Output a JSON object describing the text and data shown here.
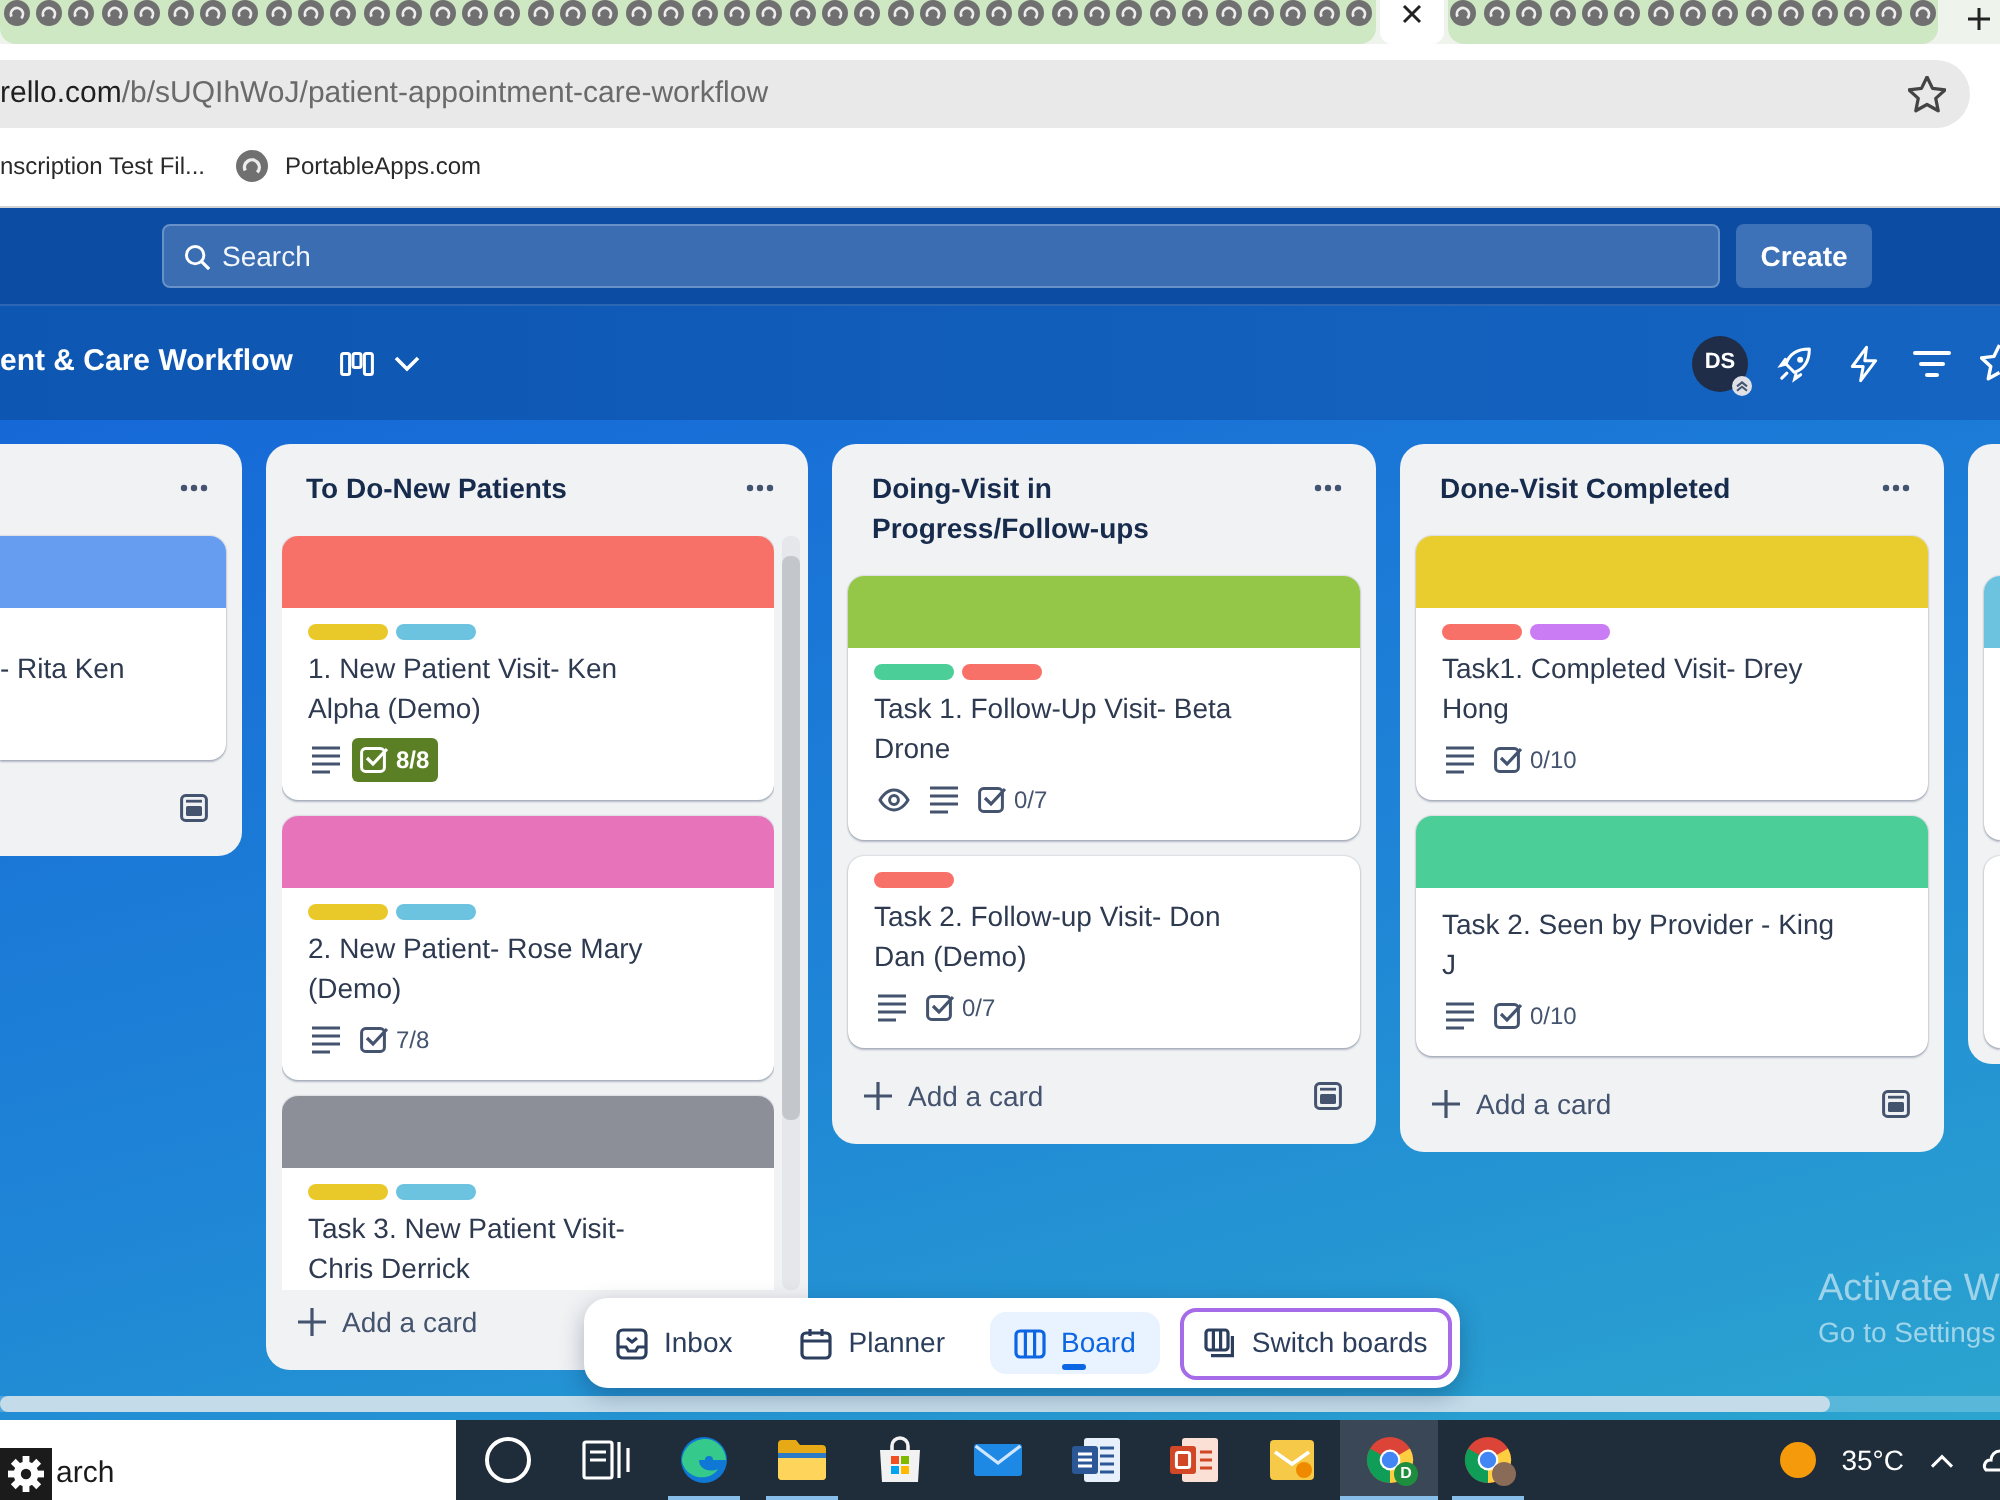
{
  "browser": {
    "tab_groups": [
      {
        "color": "#cfe8c4",
        "tabs": [
          {
            "selected": false
          },
          {
            "selected": false
          },
          {
            "selected": false
          },
          {
            "selected": false
          },
          {
            "selected": false
          },
          {
            "selected": false
          },
          {
            "selected": false
          },
          {
            "selected": false
          },
          {
            "selected": false
          },
          {
            "selected": false
          },
          {
            "selected": false
          },
          {
            "selected": false
          },
          {
            "selected": false
          },
          {
            "selected": false
          },
          {
            "selected": false
          },
          {
            "selected": false
          },
          {
            "selected": false
          },
          {
            "selected": false
          },
          {
            "selected": false
          },
          {
            "selected": false
          },
          {
            "selected": false
          },
          {
            "selected": false
          },
          {
            "selected": false
          },
          {
            "selected": false
          },
          {
            "selected": false
          },
          {
            "selected": false
          },
          {
            "selected": false
          },
          {
            "selected": false
          },
          {
            "selected": false
          },
          {
            "selected": false
          },
          {
            "selected": false
          },
          {
            "selected": false
          },
          {
            "selected": false
          },
          {
            "selected": false
          },
          {
            "selected": false
          },
          {
            "selected": false
          },
          {
            "selected": false
          },
          {
            "selected": false
          },
          {
            "selected": false
          },
          {
            "selected": false
          },
          {
            "selected": false
          },
          {
            "selected": false
          }
        ]
      },
      {
        "tabs": [
          {
            "selected": true
          }
        ]
      },
      {
        "color": "#cfe8c4",
        "tabs": [
          {
            "selected": false
          },
          {
            "selected": false
          },
          {
            "selected": false
          },
          {
            "selected": false
          },
          {
            "selected": false
          },
          {
            "selected": false
          },
          {
            "selected": false
          },
          {
            "selected": false
          },
          {
            "selected": false
          },
          {
            "selected": false
          },
          {
            "selected": false
          },
          {
            "selected": false
          },
          {
            "selected": false
          },
          {
            "selected": false
          },
          {
            "selected": false
          }
        ]
      }
    ],
    "address_bar": {
      "host": "rello.com",
      "path": "/b/sUQIhWoJ/patient-appointment-care-workflow"
    },
    "bookmarks": [
      {
        "label": "nscription Test Fil..."
      },
      {
        "label": "PortableApps.com",
        "icon": true
      }
    ]
  },
  "top_bar": {
    "search": {
      "placeholder": "Search"
    },
    "create_label": "Create"
  },
  "board_header": {
    "title": "ent & Care Workflow",
    "avatar": {
      "initials": "DS"
    }
  },
  "lists": [
    {
      "cards": [
        {
          "color": "#669df1",
          "title": "- Rita Ken"
        }
      ],
      "template": true
    },
    {
      "title": "To Do-New Patients",
      "overflow": true,
      "cards": [
        {
          "color": "#f87168",
          "labels": [
            {
              "color": "#e9c92a"
            },
            {
              "color": "#6cc3e0"
            }
          ],
          "title": "1. New Patient Visit- Ken Alpha (Demo)",
          "description": true,
          "checklist": {
            "text": "8/8",
            "complete": true
          }
        },
        {
          "color": "#e774bb",
          "labels": [
            {
              "color": "#e9c92a"
            },
            {
              "color": "#6cc3e0"
            }
          ],
          "title": "2. New Patient- Rose Mary (Demo)",
          "description": true,
          "checklist": {
            "text": "7/8",
            "complete": false
          }
        },
        {
          "color": "#8c8f97",
          "labels": [
            {
              "color": "#e9c92a"
            },
            {
              "color": "#6cc3e0"
            }
          ],
          "title": "Task 3. New Patient Visit- Chris Derrick"
        }
      ],
      "add_label": "Add a card"
    },
    {
      "title": "Doing-Visit in Progress/Follow-ups",
      "cards": [
        {
          "color": "#94c748",
          "labels": [
            {
              "color": "#4bce97"
            },
            {
              "color": "#f87168"
            }
          ],
          "title": "Task 1. Follow-Up Visit- Beta Drone",
          "watching": true,
          "description": true,
          "checklist": {
            "text": "0/7",
            "complete": false
          }
        },
        {
          "labels": [
            {
              "color": "#f87168"
            }
          ],
          "title": "Task 2. Follow-up Visit- Don Dan (Demo)",
          "description": true,
          "checklist": {
            "text": "0/7",
            "complete": false
          }
        }
      ],
      "add_label": "Add a card",
      "template": true
    },
    {
      "title": "Done-Visit Completed",
      "cards": [
        {
          "color": "#e9cd2f",
          "labels": [
            {
              "color": "#f87168"
            },
            {
              "color": "#c97cf4"
            }
          ],
          "title": "Task1. Completed Visit- Drey Hong",
          "description": true,
          "checklist": {
            "text": "0/10",
            "complete": false
          }
        },
        {
          "color": "#4bce97",
          "title": "Task 2. Seen by Provider - King J",
          "description": true,
          "checklist": {
            "text": "0/10",
            "complete": false
          }
        }
      ],
      "add_label": "Add a card",
      "template": true
    },
    {
      "cards": [
        {
          "kind": "sliver",
          "color": "#6cc3e0"
        },
        {
          "kind": "sliver"
        }
      ]
    }
  ],
  "bottom_nav": [
    {
      "kind": "inbox",
      "label": "Inbox",
      "selected": false
    },
    {
      "kind": "planner",
      "label": "Planner",
      "selected": false
    },
    {
      "kind": "board",
      "label": "Board",
      "selected": true
    },
    {
      "kind": "switcher",
      "label": "Switch boards",
      "selected": false
    }
  ],
  "windows_notice": {
    "title": "Activate W",
    "subtitle": "Go to Settings"
  },
  "taskbar": {
    "search": {
      "placeholder": "arch"
    },
    "apps": [
      {
        "kind": "ring",
        "running": false,
        "selected": false
      },
      {
        "kind": "taskview",
        "running": false,
        "selected": false
      },
      {
        "kind": "swirl",
        "running": true,
        "selected": false
      },
      {
        "kind": "folder",
        "running": true,
        "selected": false
      },
      {
        "kind": "bag",
        "running": false,
        "selected": false
      },
      {
        "kind": "envelope",
        "running": false,
        "selected": false
      },
      {
        "kind": "doc-blue",
        "running": false,
        "selected": false
      },
      {
        "kind": "doc-red",
        "running": false,
        "selected": false
      },
      {
        "kind": "doc-yellow",
        "running": false,
        "selected": false
      },
      {
        "kind": "browser",
        "running": true,
        "selected": true,
        "badge": "D"
      },
      {
        "kind": "browser",
        "running": true,
        "selected": false,
        "avatar": true
      }
    ],
    "weather": "35°C"
  }
}
